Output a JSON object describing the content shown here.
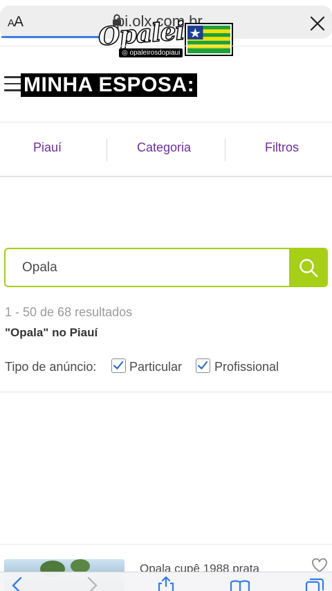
{
  "browser": {
    "text_size_button": "AA",
    "domain": "piaui.olx.com.br",
    "domain_visible": "pi.olx.com.br"
  },
  "overlay": {
    "logo_text": "Opaleiros",
    "logo_handle": "opaleirosdopiaui",
    "caption": "MINHA ESPOSA:"
  },
  "nav": {
    "items": [
      "Piauí",
      "Categoria",
      "Filtros"
    ]
  },
  "search": {
    "value": "Opala"
  },
  "results": {
    "count_text": "1 - 50 de 68 resultados",
    "query_text": "\"Opala\" no Piauí"
  },
  "filters": {
    "type_label": "Tipo de anúncio:",
    "options": [
      {
        "label": "Particular",
        "checked": true
      },
      {
        "label": "Profissional",
        "checked": true
      }
    ]
  },
  "listing": {
    "title": "Opala cupê 1988 prata"
  },
  "colors": {
    "accent_green": "#a6cf16",
    "nav_purple": "#6a2ea0",
    "load_blue": "#3d7de3"
  }
}
